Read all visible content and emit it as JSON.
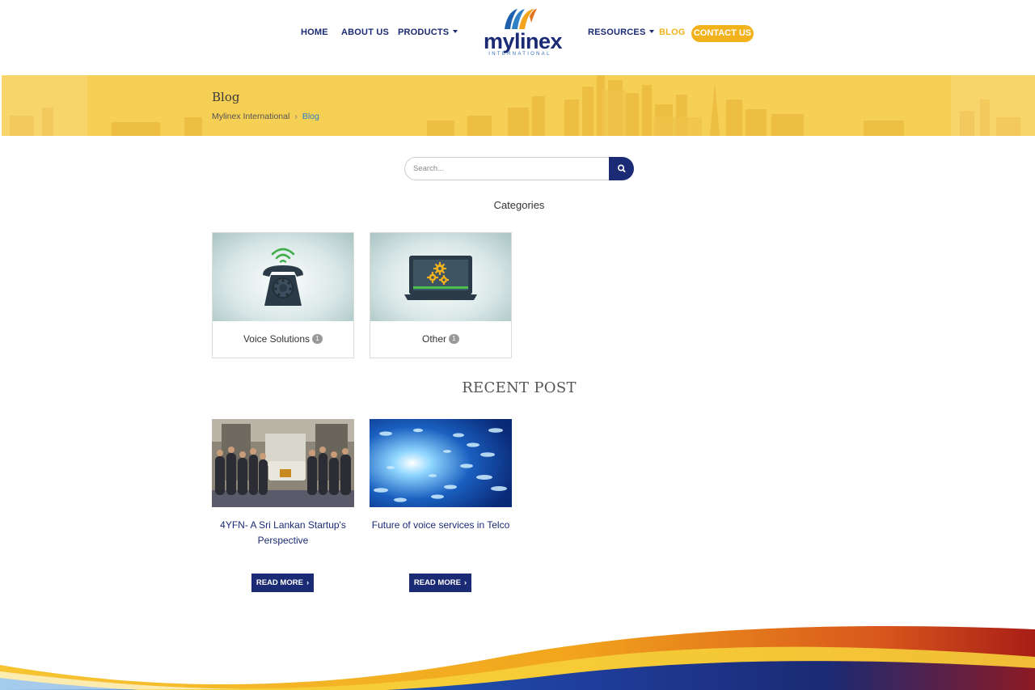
{
  "nav": {
    "home": "HOME",
    "about": "ABOUT US",
    "products": "PRODUCTS",
    "resources": "RESOURCES",
    "blog": "BLOG",
    "contact": "CONTACT US"
  },
  "logo": {
    "word": "mylinex",
    "sub": "INTERNATIONAL"
  },
  "banner": {
    "title": "Blog",
    "breadcrumb": {
      "home": "Mylinex International",
      "current": "Blog"
    }
  },
  "search": {
    "placeholder": "Search..."
  },
  "categories": {
    "heading": "Categories",
    "items": [
      {
        "label": "Voice Solutions",
        "count": "1",
        "icon": "telephone-icon"
      },
      {
        "label": "Other",
        "count": "1",
        "icon": "laptop-gears-icon"
      }
    ]
  },
  "recent": {
    "heading": "RECENT POST",
    "posts": [
      {
        "title": "4YFN- A Sri Lankan Startup's Perspective",
        "button": "READ MORE",
        "image": "group-photo"
      },
      {
        "title": "Future of voice services in Telco",
        "button": "READ MORE",
        "image": "data-tunnel"
      }
    ]
  },
  "colors": {
    "brand_navy": "#1b2a74",
    "accent_yellow": "#f2b21c",
    "banner_yellow": "#f6cf55",
    "link_blue": "#2f80c4"
  }
}
